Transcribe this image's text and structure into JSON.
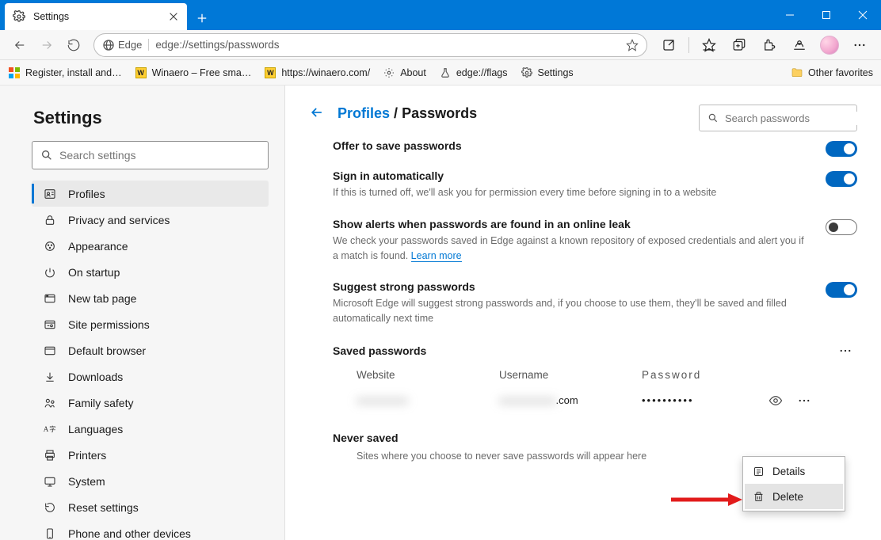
{
  "tab": {
    "title": "Settings"
  },
  "toolbar": {
    "scheme_label": "Edge",
    "url": "edge://settings/passwords"
  },
  "bookmarks": {
    "items": [
      {
        "label": "Register, install and…"
      },
      {
        "label": "Winaero – Free sma…"
      },
      {
        "label": "https://winaero.com/"
      },
      {
        "label": "About"
      },
      {
        "label": "edge://flags"
      },
      {
        "label": "Settings"
      }
    ],
    "other": "Other favorites"
  },
  "sidebar": {
    "title": "Settings",
    "search_placeholder": "Search settings",
    "items": [
      "Profiles",
      "Privacy and services",
      "Appearance",
      "On startup",
      "New tab page",
      "Site permissions",
      "Default browser",
      "Downloads",
      "Family safety",
      "Languages",
      "Printers",
      "System",
      "Reset settings",
      "Phone and other devices"
    ]
  },
  "main": {
    "breadcrumb_root": "Profiles",
    "breadcrumb_leaf": "Passwords",
    "search_pw_placeholder": "Search passwords",
    "settings": {
      "offer": {
        "title": "Offer to save passwords"
      },
      "signin": {
        "title": "Sign in automatically",
        "desc": "If this is turned off, we'll ask you for permission every time before signing in to a website"
      },
      "leak": {
        "title": "Show alerts when passwords are found in an online leak",
        "desc": "We check your passwords saved in Edge against a known repository of exposed credentials and alert you if a match is found. ",
        "learn": "Learn more"
      },
      "suggest": {
        "title": "Suggest strong passwords",
        "desc": "Microsoft Edge will suggest strong passwords and, if you choose to use them, they'll be saved and filled automatically next time"
      }
    },
    "saved": {
      "title": "Saved passwords",
      "cols": {
        "web": "Website",
        "user": "Username",
        "pw": "Password"
      },
      "row0": {
        "web": "xxxxxxxxxx",
        "user_blur": "xxxxxxxxxxx",
        "user_suffix": ".com",
        "pw": "••••••••••"
      }
    },
    "context": {
      "details": "Details",
      "delete": "Delete"
    },
    "never": {
      "title": "Never saved",
      "desc": "Sites where you choose to never save passwords will appear here"
    }
  }
}
